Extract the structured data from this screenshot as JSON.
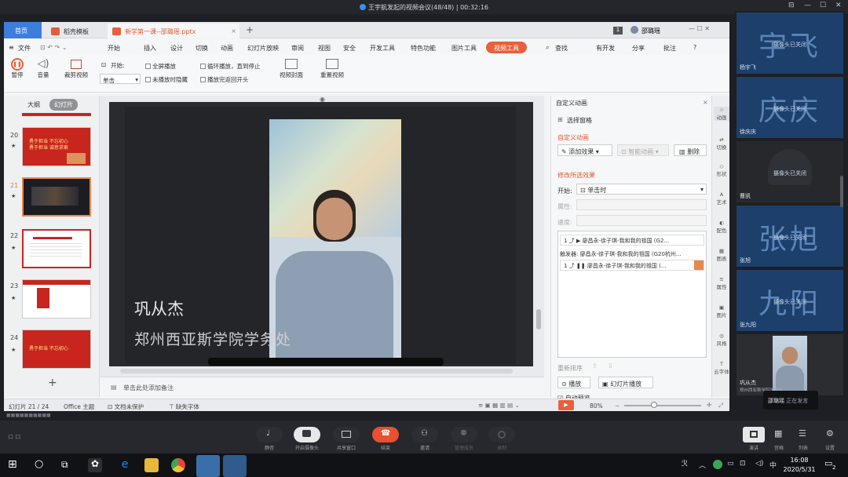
{
  "meeting": {
    "title": "王宇航发起的视频会议(48/48)",
    "duration": "00:32:16"
  },
  "wps": {
    "tabs": {
      "home": "首页",
      "template": "稻壳模板",
      "file": "新学第一课--邵璐瑶.pptx"
    },
    "page_badge": "1",
    "user": "邵璐瑶",
    "menu": {
      "file": "文件",
      "items": [
        "开始",
        "插入",
        "设计",
        "切换",
        "动画",
        "幻灯片放映",
        "审阅",
        "视图",
        "安全",
        "开发工具",
        "特色功能",
        "图片工具"
      ],
      "video_tools": "视频工具",
      "search": "查找",
      "unsaved": "有开发",
      "share": "分享",
      "comment": "批注",
      "help": "?"
    },
    "toolbar": {
      "pause": "暂停",
      "volume": "音量",
      "clip": "裁剪视频",
      "start_label": "开始:",
      "start_value": "单击",
      "fullscreen": "全屏播放",
      "hide": "未播放时隐藏",
      "loop": "循环播放，直到停止",
      "rewind": "播放完返回开头",
      "cover": "视频封面",
      "reset": "重置视频"
    },
    "thumb_tabs": {
      "outline": "大纲",
      "slides": "幻灯片"
    },
    "slides": [
      {
        "num": "20",
        "text": "勇于担当  不忘初心\n勇于担当  诚意求索"
      },
      {
        "num": "21",
        "text": ""
      },
      {
        "num": "22",
        "text": ""
      },
      {
        "num": "23",
        "text": ""
      },
      {
        "num": "24",
        "text": "勇于担当  不忘初心"
      }
    ],
    "slide_content": {
      "person_name": "巩从杰",
      "org": "郑州西亚斯学院学务处"
    },
    "notes": "单击此处添加备注",
    "status": {
      "slide": "幻灯片 21 / 24",
      "theme": "Office 主题",
      "protect": "文档未保护",
      "font": "缺失字体",
      "zoom": "80%"
    },
    "anim_panel": {
      "title": "自定义动画",
      "select_pane": "选择窗格",
      "custom_anim": "自定义动画",
      "add_effect": "添加效果",
      "smart_anim": "智能动画",
      "delete": "删除",
      "modify": "修改所选效果",
      "start_label": "开始:",
      "start_value": "单击时",
      "prop_label": "属性:",
      "speed_label": "速度:",
      "item1": "廖昌永-徐子琪-我和我的祖国 (G2...",
      "trigger": "触发器: 廖昌永-徐子琪-我和我的祖国 (G20杭州...",
      "item2": "廖昌永-徐子琪-我和我的祖国 (...",
      "reorder": "重新排序",
      "play": "播放",
      "slideshow": "幻灯片播放",
      "auto_preview": "自动预览"
    },
    "right_strip": [
      "动画",
      "切换",
      "形状",
      "艺术",
      "配色",
      "图表",
      "属性",
      "图片",
      "风格",
      "云字体"
    ]
  },
  "participants": [
    {
      "big": "宇飞",
      "cam": "摄像头已关闭",
      "name": "杨宇飞"
    },
    {
      "big": "庆庆",
      "cam": "摄像头已关闭",
      "name": "徐庆庆"
    },
    {
      "big": "",
      "cam": "摄像头已关闭",
      "name": "曹凯"
    },
    {
      "big": "张旭",
      "cam": "摄像头已关闭",
      "name": "张旭"
    },
    {
      "big": "九阳",
      "cam": "摄像头已关闭",
      "name": "张九阳"
    },
    {
      "big": "",
      "cam": "",
      "name": "巩从杰",
      "sub": "郑州西亚斯学院学务处"
    }
  ],
  "speaking": {
    "name": "邵璐瑶",
    "status": "正在发言"
  },
  "controls": [
    "静音",
    "开启摄像头",
    "共享窗口",
    "结束",
    "邀请",
    "管理成员",
    "录制"
  ],
  "view_controls": [
    "演讲",
    "宫格",
    "列表",
    "设置"
  ],
  "status_left": "口 口",
  "taskbar": {
    "time": "16:08",
    "date": "2020/5/31",
    "ime": "中",
    "notif": "2"
  }
}
